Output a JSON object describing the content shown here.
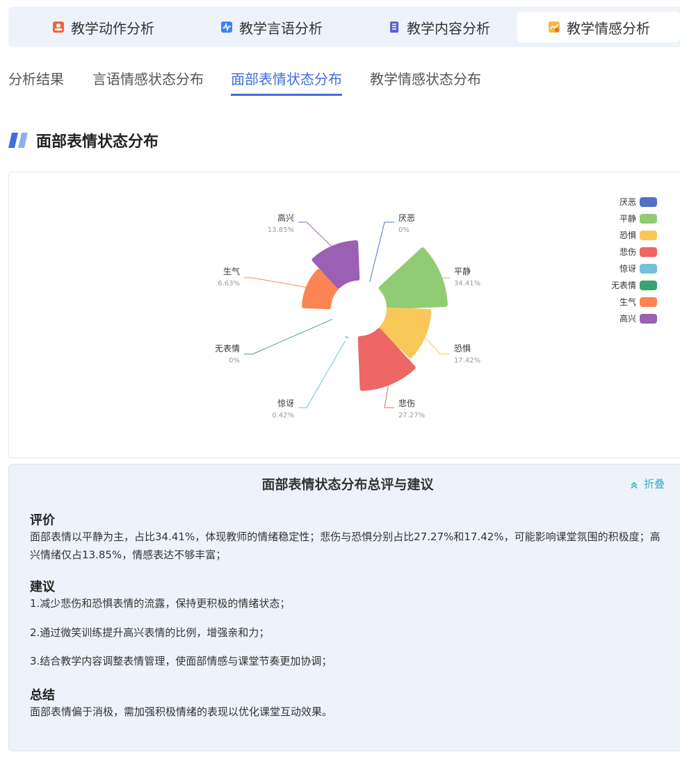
{
  "module_tabs": [
    {
      "label": "教学动作分析",
      "icon": "teacher-icon",
      "color": "#f0663a"
    },
    {
      "label": "教学言语分析",
      "icon": "speech-wave-icon",
      "color": "#3b82f6"
    },
    {
      "label": "教学内容分析",
      "icon": "document-icon",
      "color": "#5b5fd6"
    },
    {
      "label": "教学情感分析",
      "icon": "emotion-chart-icon",
      "color": "#f5b93a",
      "active": true
    }
  ],
  "sub_tabs": [
    {
      "label": "分析结果"
    },
    {
      "label": "言语情感状态分布"
    },
    {
      "label": "面部表情状态分布",
      "active": true
    },
    {
      "label": "教学情感状态分布"
    }
  ],
  "section_title": "面部表情状态分布",
  "chart_data": {
    "type": "nightingale-rose",
    "series": [
      {
        "name": "厌恶",
        "value": 0,
        "pct": "0%",
        "color": "#5470c6"
      },
      {
        "name": "平静",
        "value": 34.41,
        "pct": "34.41%",
        "color": "#91cc75"
      },
      {
        "name": "恐惧",
        "value": 17.42,
        "pct": "17.42%",
        "color": "#fac858"
      },
      {
        "name": "悲伤",
        "value": 27.27,
        "pct": "27.27%",
        "color": "#ee6666"
      },
      {
        "name": "惊讶",
        "value": 0.42,
        "pct": "0.42%",
        "color": "#73c0de"
      },
      {
        "name": "无表情",
        "value": 0,
        "pct": "0%",
        "color": "#3ba272"
      },
      {
        "name": "生气",
        "value": 6.63,
        "pct": "6.63%",
        "color": "#fc8452"
      },
      {
        "name": "高兴",
        "value": 13.85,
        "pct": "13.85%",
        "color": "#9a60b4"
      }
    ],
    "legend_position": "top-right"
  },
  "summary": {
    "title": "面部表情状态分布总评与建议",
    "fold_label": "折叠",
    "eval_heading": "评价",
    "eval_text": "面部表情以平静为主，占比34.41%，体现教师的情绪稳定性；悲伤与恐惧分别占比27.27%和17.42%，可能影响课堂氛围的积极度；高兴情绪仅占13.85%，情感表达不够丰富；",
    "advice_heading": "建议",
    "advice": [
      "1.减少悲伤和恐惧表情的流露，保持更积极的情绪状态；",
      "2.通过微笑训练提升高兴表情的比例，增强亲和力；",
      "3.结合教学内容调整表情管理，使面部情感与课堂节奏更加协调；"
    ],
    "conclusion_heading": "总结",
    "conclusion_text": "面部表情偏于消极，需加强积极情绪的表现以优化课堂互动效果。"
  }
}
